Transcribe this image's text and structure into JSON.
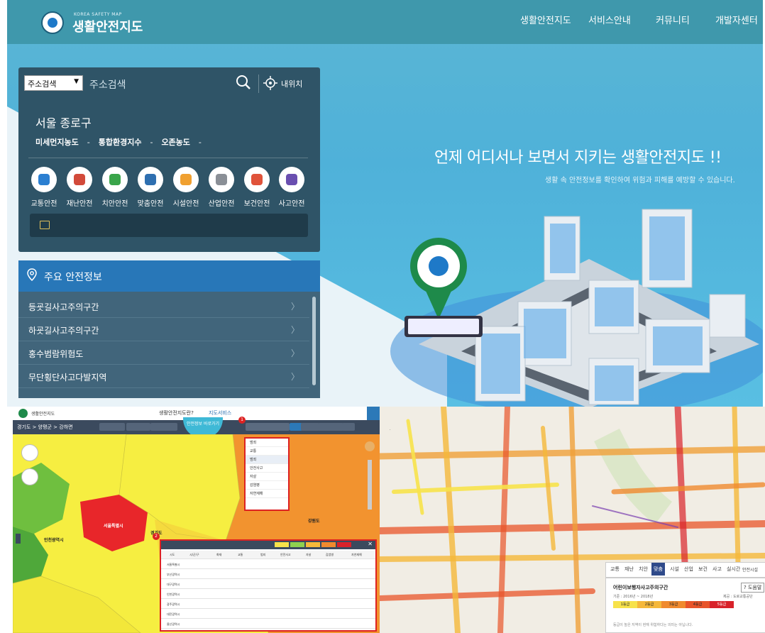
{
  "header": {
    "logo_sub": "KOREA SAFETY MAP",
    "logo_title": "생활안전지도",
    "nav": [
      "생활안전지도",
      "서비스안내",
      "커뮤니티",
      "개발자센터"
    ]
  },
  "search": {
    "select_value": "주소검색",
    "placeholder": "주소검색",
    "my_location": "내위치"
  },
  "location": {
    "region": "서울 종로구",
    "metrics": [
      "미세먼지농도",
      "-",
      "통합환경지수",
      "-",
      "오존농도",
      "-"
    ]
  },
  "categories": [
    {
      "label": "교통안전",
      "icon": "car-icon",
      "color": "#2b7fd1"
    },
    {
      "label": "재난안전",
      "icon": "house-fire-icon",
      "color": "#d24a3a"
    },
    {
      "label": "치안안전",
      "icon": "siren-icon",
      "color": "#3aa54a"
    },
    {
      "label": "맞춤안전",
      "icon": "family-icon",
      "color": "#2e6fb0"
    },
    {
      "label": "시설안전",
      "icon": "cone-icon",
      "color": "#f0a030"
    },
    {
      "label": "산업안전",
      "icon": "factory-icon",
      "color": "#8a8f96"
    },
    {
      "label": "보건안전",
      "icon": "medkit-icon",
      "color": "#e0533a"
    },
    {
      "label": "사고안전",
      "icon": "person-icon",
      "color": "#6a4fb0"
    }
  ],
  "safety_info": {
    "title": "주요 안전정보",
    "items": [
      "등굣길사고주의구간",
      "하굣길사고주의구간",
      "홍수범람위험도",
      "무단횡단사고다발지역"
    ]
  },
  "hero": {
    "headline": "언제 어디서나 보면서 지키는 생활안전지도 !!",
    "subline": "생활 속 안전정보를 확인하여 위험과 피해를 예방할 수 있습니다."
  },
  "screenshot_left": {
    "title": "생활안전지도",
    "question": "생활안전지도란?",
    "service": "지도서비스",
    "breadcrumb": "경기도 > 양평군 > 강하면",
    "go_button": "안전정보 바로가기",
    "dropdown_items": [
      "범죄",
      "교통",
      "범죄",
      "안전사고",
      "자살",
      "감염병",
      "자연재해"
    ],
    "badges": [
      "1",
      "2"
    ],
    "map_labels": [
      "서울특별시",
      "인천광역시",
      "강원도",
      "경기도"
    ],
    "controls": [
      "안전시설",
      "위치기반정보"
    ],
    "table_headers": [
      "시도",
      "시/군/구",
      "화재",
      "교통",
      "범죄",
      "안전사고",
      "자살",
      "감염병",
      "자연재해"
    ],
    "table_regions": [
      "서울특별시",
      "부산광역시",
      "대구광역시",
      "인천광역시",
      "광주광역시",
      "대전광역시",
      "울산광역시"
    ],
    "table_grades": [
      "1등급",
      "2등급",
      "3등급",
      "4등급",
      "5등급"
    ]
  },
  "screenshot_right": {
    "tabs": [
      "교통",
      "재난",
      "치안",
      "맞춤",
      "시설",
      "산업",
      "보건",
      "사고",
      "실시간",
      "안전시설"
    ],
    "active_tab": "맞춤",
    "legend_title": "어린이보행자사고주의구간",
    "help": "? 도움말",
    "legend_sub": "기준 : 2016년 ~ 2018년",
    "legend_source": "제공 : 도로교통공단",
    "grades": [
      "1등급",
      "2등급",
      "3등급",
      "4등급",
      "5등급"
    ],
    "grade_colors": [
      "#f7e24a",
      "#f5b83a",
      "#f08a2e",
      "#e8542a",
      "#d8222a"
    ],
    "note": "등급이 높은 지역이 현재 위험하다는 의미는 아닙니다."
  }
}
